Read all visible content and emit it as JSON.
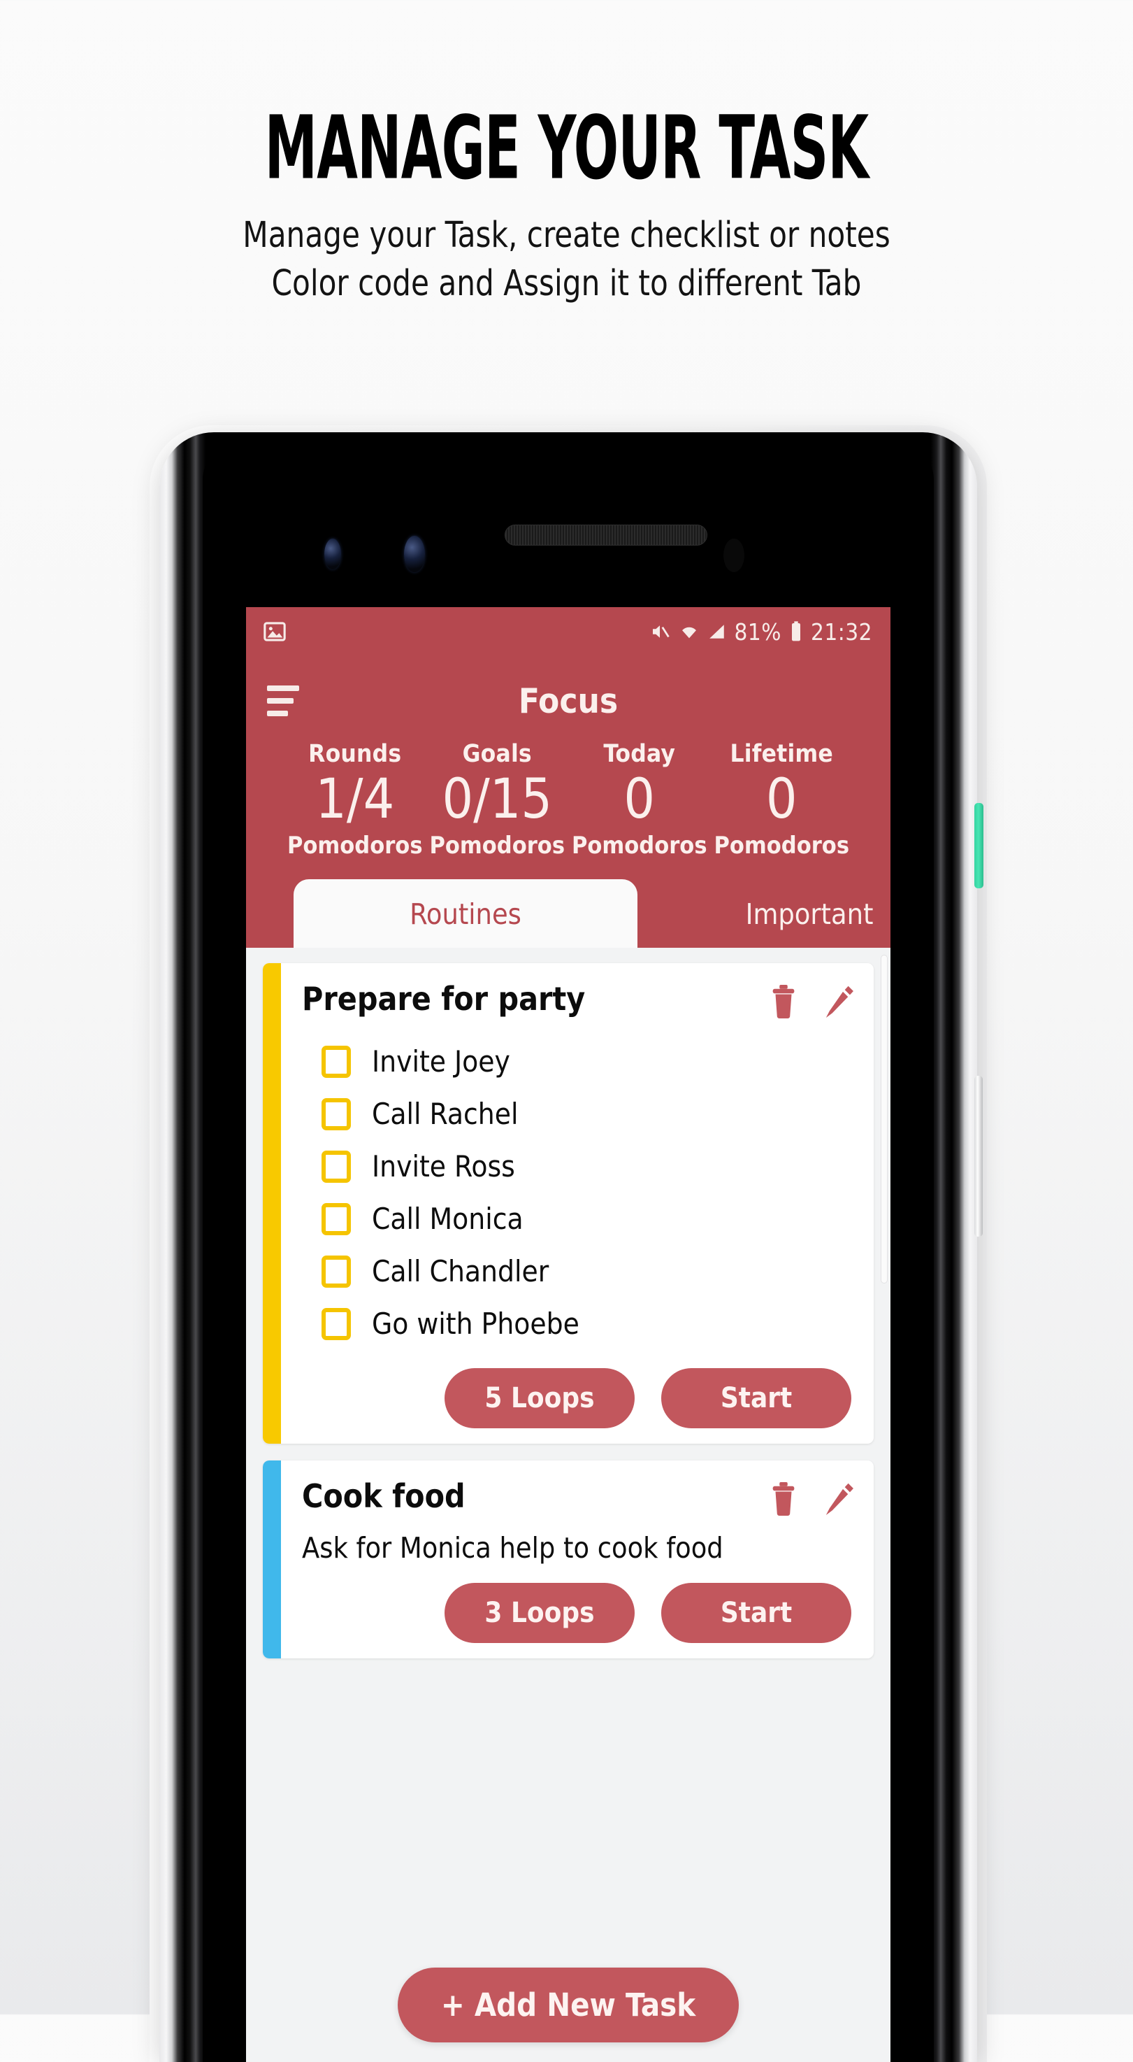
{
  "promo": {
    "title": "MANAGE YOUR TASK",
    "subtitle_line1": "Manage your Task, create checklist or notes",
    "subtitle_line2": "Color code and Assign it to different Tab"
  },
  "statusbar": {
    "left_icon": "image-icon",
    "mute_icon": "mute-icon",
    "wifi_icon": "wifi-icon",
    "signal_icon": "signal-icon",
    "battery_percent": "81%",
    "battery_icon": "battery-icon",
    "time": "21:32"
  },
  "appbar": {
    "menu_icon": "hamburger-menu-icon",
    "title": "Focus"
  },
  "stats": [
    {
      "label": "Rounds",
      "value": "1/4",
      "unit": "Pomodoros"
    },
    {
      "label": "Goals",
      "value": "0/15",
      "unit": "Pomodoros"
    },
    {
      "label": "Today",
      "value": "0",
      "unit": "Pomodoros"
    },
    {
      "label": "Lifetime",
      "value": "0",
      "unit": "Pomodoros"
    }
  ],
  "tabs": [
    {
      "label": "Routines",
      "active": true
    },
    {
      "label": "Important",
      "active": false
    }
  ],
  "cards": [
    {
      "title": "Prepare for party",
      "stripe_color": "#f8c900",
      "checkbox_color": "#f5c400",
      "delete_icon": "trash-icon",
      "edit_icon": "pencil-icon",
      "checklist": [
        "Invite Joey",
        "Call Rachel",
        "Invite Ross",
        "Call Monica",
        "Call Chandler",
        "Go with Phoebe"
      ],
      "note": "",
      "loops_label": "5 Loops",
      "start_label": "Start"
    },
    {
      "title": "Cook food",
      "stripe_color": "#40b8eb",
      "checkbox_color": "#40b8eb",
      "delete_icon": "trash-icon",
      "edit_icon": "pencil-icon",
      "checklist": [],
      "note": "Ask for Monica help to cook food",
      "loops_label": "3 Loops",
      "start_label": "Start"
    }
  ],
  "add_task_button": "+ Add New Task",
  "colors": {
    "accent_red": "#b5484f",
    "button_red": "#c2575d",
    "yellow": "#f8c900",
    "blue": "#40b8eb",
    "screen_bg": "#f2f3f4",
    "power_button_green": "#3cd9a6"
  },
  "device": {
    "power_button": "power-button",
    "volume_button": "volume-button",
    "front_camera_1": "camera-lens",
    "front_camera_2": "camera-lens",
    "earpiece": "speaker-grille",
    "proximity_sensor": "proximity-sensor"
  }
}
